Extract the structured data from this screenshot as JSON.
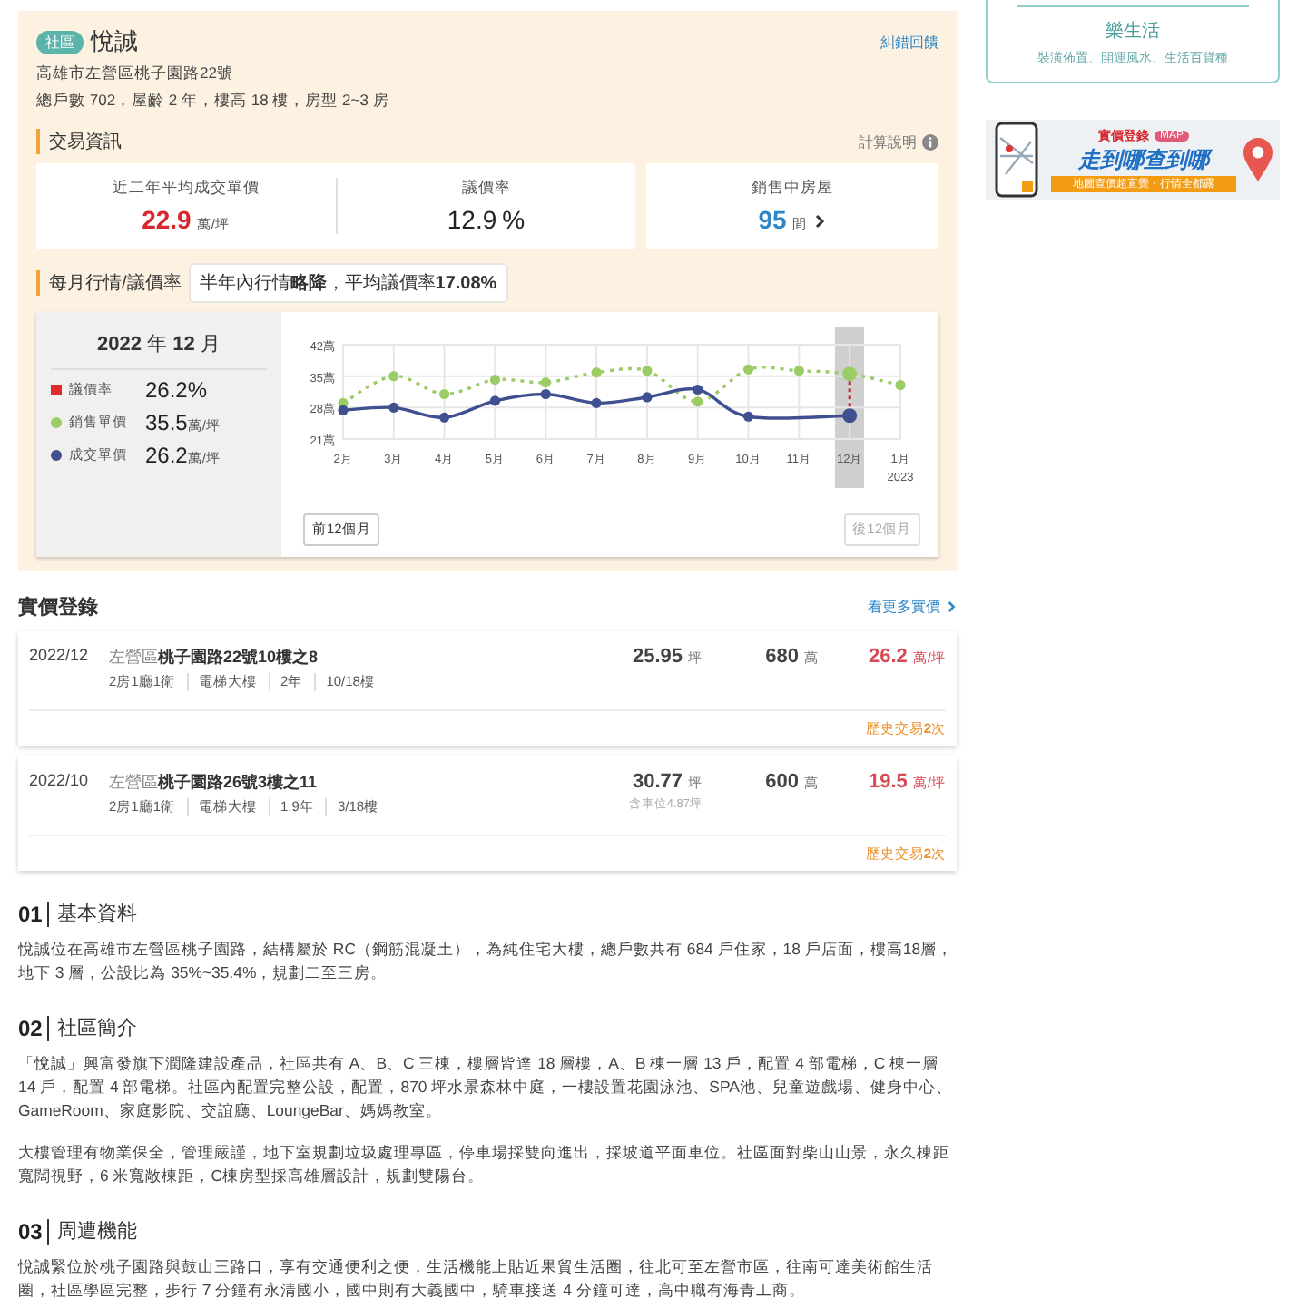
{
  "community": {
    "tag": "社區",
    "name": "悅誠",
    "feedback_link": "糾錯回饋",
    "address": "高雄市左營區桃子園路22號",
    "summary": "總戶數 702，屋齡 2 年，樓高 18 樓，房型 2~3 房"
  },
  "trade_info": {
    "title": "交易資訊",
    "help": "計算說明",
    "stats": [
      {
        "kind": "price",
        "label": "近二年平均成交單價",
        "value": "22.9",
        "unit": "萬/坪"
      },
      {
        "kind": "rate",
        "label": "議價率",
        "value": "12.9",
        "unit": "%"
      },
      {
        "kind": "link",
        "label": "銷售中房屋",
        "value": "95",
        "unit": "間"
      }
    ]
  },
  "monthly": {
    "title": "每月行情/議價率",
    "tip": "半年內行情**略降**，平均議價率**17.08%**",
    "panel": {
      "latest_highlighted": true,
      "date": "**2022** 年 **12** 月",
      "legend": [
        {
          "kind": "square",
          "color": "#e02b2b",
          "label": "議價率",
          "value": "26.2%"
        },
        {
          "kind": "series",
          "value": "35.5",
          "unit": "萬/坪"
        },
        {
          "kind": "series",
          "value": "26.2",
          "unit": "萬/坪"
        }
      ]
    },
    "chart_data": {
      "type": "line",
      "grid": true,
      "categories": [
        "2月",
        "3月",
        "4月",
        "5月",
        "6月",
        "7月",
        "8月",
        "9月",
        "10月",
        "11月",
        "12月",
        "1月"
      ],
      "ylim": [
        21,
        42
      ],
      "yticks": [
        {
          "value": 21,
          "label": "21萬"
        },
        {
          "value": 28,
          "label": "28萬"
        },
        {
          "value": 35,
          "label": "35萬"
        },
        {
          "value": 42,
          "label": "42萬"
        }
      ],
      "series": [
        {
          "name": "銷售單價",
          "color": "#9ccc65",
          "line_style": "dotted",
          "marker": "circle",
          "values": [
            29,
            35,
            31,
            34.2,
            33.6,
            35.8,
            36.2,
            29.3,
            36.5,
            36.2,
            35.5,
            33
          ]
        },
        {
          "name": "成交單價",
          "color": "#3f4f8f",
          "line_style": "solid",
          "marker": "circle",
          "values": [
            27.4,
            28,
            25.8,
            29.5,
            31,
            29,
            30.3,
            32,
            26,
            null,
            26.2,
            null
          ]
        }
      ],
      "annotations": [
        "2023"
      ]
    },
    "buttons": [
      {
        "label": "前12個月",
        "disabled": false
      },
      {
        "label": "後12個月",
        "disabled": true
      }
    ]
  },
  "records": {
    "title": "實價登錄",
    "more_link": "看更多實價",
    "rows": [
      {
        "date": "2022/12",
        "district": "左營區",
        "address": "桃子園路22號10樓之8",
        "tags": [
          "2房1廳1衛",
          "電梯大樓",
          "2年",
          "10/18樓"
        ],
        "area": "25.95",
        "area_unit": "坪",
        "total": "680",
        "total_unit": "萬",
        "unit_price": "26.2",
        "unit_price_unit": "萬/坪",
        "history": "歷史交易**2**次"
      },
      {
        "date": "2022/10",
        "district": "左營區",
        "address": "桃子園路26號3樓之11",
        "tags": [
          "2房1廳1衛",
          "電梯大樓",
          "1.9年",
          "3/18樓"
        ],
        "area": "30.77",
        "area_unit": "坪",
        "area_note": "含車位4.87坪",
        "total": "600",
        "total_unit": "萬",
        "unit_price": "19.5",
        "unit_price_unit": "萬/坪",
        "history": "歷史交易**2**次"
      }
    ]
  },
  "sections": [
    {
      "number": "01",
      "title": "基本資料",
      "paragraphs": [
        "悅誠位在高雄市左營區桃子園路，結構屬於 RC（鋼筋混凝土），為純住宅大樓，總戶數共有 684 戶住家，18 戶店面，樓高18層，地下 3 層，公設比為 35%~35.4%，規劃二至三房。"
      ]
    },
    {
      "number": "02",
      "title": "社區簡介",
      "paragraphs": [
        "「悅誠」興富發旗下潤隆建設產品，社區共有 A、B、C 三棟，樓層皆達 18 層樓，A、B 棟一層 13 戶，配置 4 部電梯，C 棟一層 14 戶，配置 4 部電梯。社區內配置完整公設，配置，870 坪水景森林中庭，一樓設置花園泳池、SPA池、兒童遊戲場、健身中心、GameRoom、家庭影院、交誼廳、LoungeBar、媽媽教室。",
        "大樓管理有物業保全，管理嚴謹，地下室規劃垃圾處理專區，停車場採雙向進出，採坡道平面車位。社區面對柴山山景，永久棟距寬闊視野，6 米寬敞棟距，C棟房型採高雄層設計，規劃雙陽台。"
      ]
    },
    {
      "number": "03",
      "title": "周遭機能",
      "paragraphs": [
        "悅誠緊位於桃子園路與鼓山三路口，享有交通便利之便，生活機能上貼近果貿生活圈，往北可至左營市區，往南可達美術館生活圈，社區學區完整，步行 7 分鐘有永清國小，國中則有大義國中，騎車接送 4 分鐘可達，高中職有海青工商。"
      ]
    }
  ],
  "sidebar": {
    "card": {
      "title": "樂生活",
      "text": "裝潢佈置、開運風水、生活百貨種"
    },
    "banner": {
      "badge": "實價登錄",
      "badge_tag": "MAP",
      "headline": "走到哪查到哪",
      "subline": "地圖查價超直覺・行情全都露"
    }
  }
}
